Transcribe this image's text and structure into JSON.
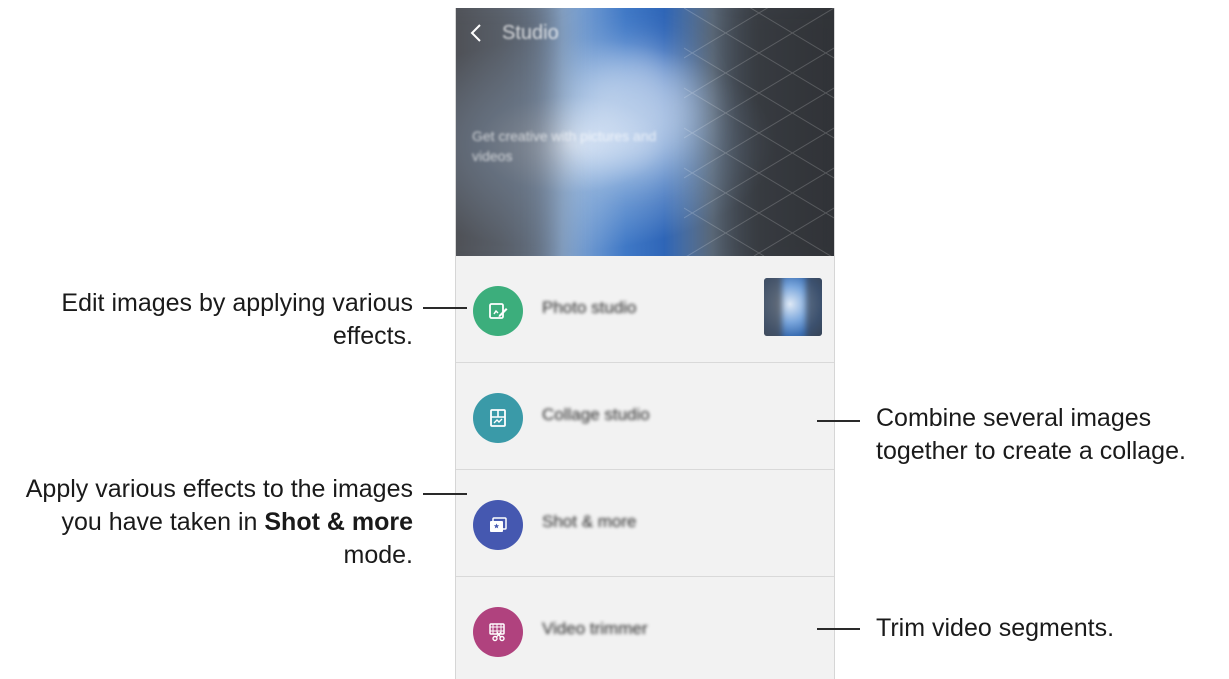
{
  "app": {
    "title": "Studio",
    "tagline": "Get creative with pictures and videos",
    "back_icon": "back-chevron-icon"
  },
  "items": [
    {
      "label": "Photo studio",
      "icon": "photo-edit-icon",
      "color": "#3cae7c",
      "has_thumbnail": true
    },
    {
      "label": "Collage studio",
      "icon": "collage-icon",
      "color": "#3a9aa8"
    },
    {
      "label": "Shot & more",
      "icon": "shot-more-icon",
      "color": "#4558b0"
    },
    {
      "label": "Video trimmer",
      "icon": "video-trim-icon",
      "color": "#b0427e"
    }
  ],
  "annotations": {
    "photo": "Edit images by applying various effects.",
    "collage": "Combine several images together to create a collage.",
    "shot_pre": "Apply various effects to the images you have taken in ",
    "shot_bold": "Shot & more",
    "shot_post": " mode.",
    "video": "Trim video segments."
  }
}
